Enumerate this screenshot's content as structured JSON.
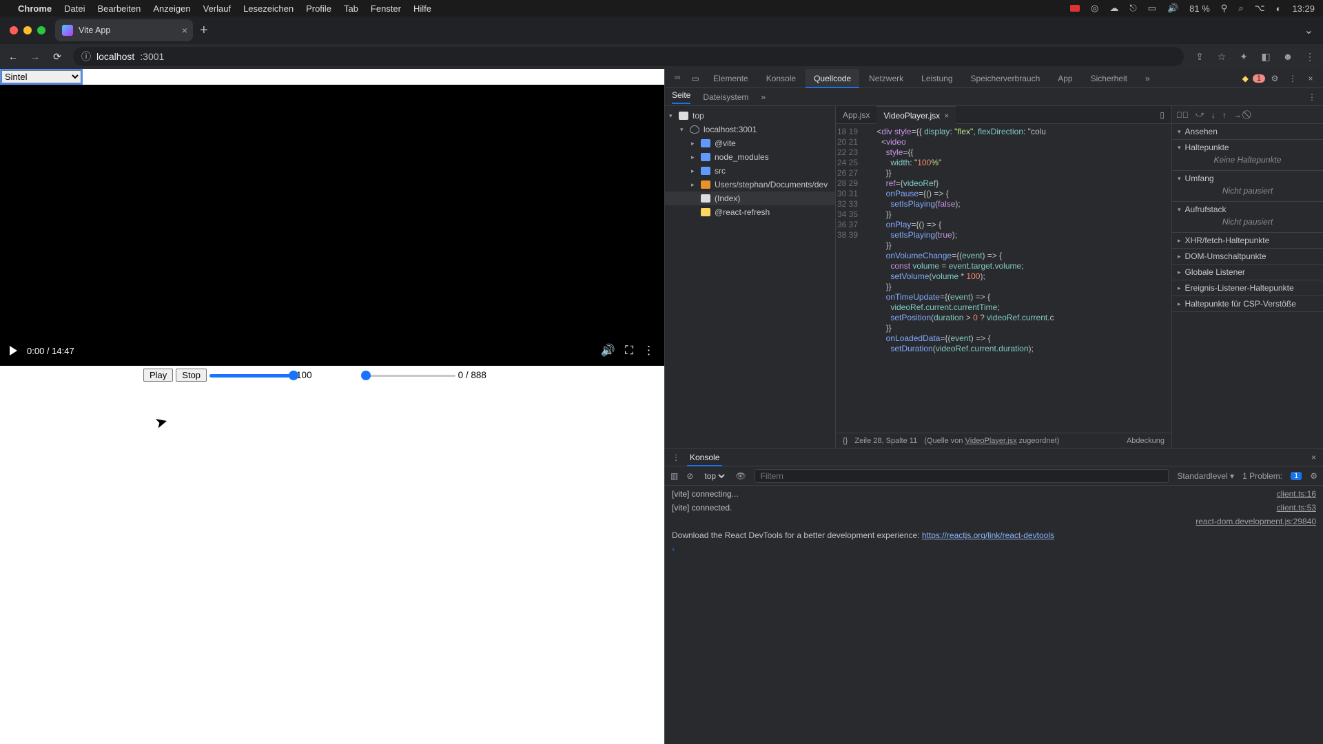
{
  "menubar": {
    "app": "Chrome",
    "items": [
      "Datei",
      "Bearbeiten",
      "Anzeigen",
      "Verlauf",
      "Lesezeichen",
      "Profile",
      "Tab",
      "Fenster",
      "Hilfe"
    ],
    "battery": "81 %",
    "clock": "13:29"
  },
  "browser": {
    "tab_title": "Vite App",
    "url_host": "localhost",
    "url_port": ":3001"
  },
  "page": {
    "select_value": "Sintel",
    "time": "0:00 / 14:47",
    "play_btn": "Play",
    "stop_btn": "Stop",
    "volume_value": "100",
    "position_value": "0 / 888"
  },
  "devtools": {
    "tabs": [
      "Elemente",
      "Konsole",
      "Quellcode",
      "Netzwerk",
      "Leistung",
      "Speicherverbrauch",
      "App",
      "Sicherheit"
    ],
    "active_tab": "Quellcode",
    "error_count": "1",
    "src_tabs": {
      "page": "Seite",
      "fs": "Dateisystem"
    },
    "tree": {
      "top": "top",
      "host": "localhost:3001",
      "vite": "@vite",
      "nm": "node_modules",
      "src": "src",
      "users": "Users/stephan/Documents/dev",
      "index": "(Index)",
      "rr": "@react-refresh"
    },
    "editor": {
      "tab1": "App.jsx",
      "tab2": "VideoPlayer.jsx",
      "first_line": 18,
      "lines": [
        "    <div style={{ display: \"flex\", flexDirection: \"colu",
        "      <video",
        "        style={{",
        "          width: \"100%\"",
        "        }}",
        "        ref={videoRef}",
        "        onPause={() => {",
        "          setIsPlaying(false);",
        "        }}",
        "        onPlay={() => {",
        "          setIsPlaying(true);",
        "        }}",
        "        onVolumeChange={(event) => {",
        "          const volume = event.target.volume;",
        "          setVolume(volume * 100);",
        "        }}",
        "        onTimeUpdate={(event) => {",
        "          videoRef.current.currentTime;",
        "          setPosition(duration > 0 ? videoRef.current.c",
        "        }}",
        "        onLoadedData={(event) => {",
        "          setDuration(videoRef.current.duration);"
      ],
      "status_pos": "Zeile 28, Spalte 11",
      "status_src_pre": "(Quelle von ",
      "status_src_link": "VideoPlayer.jsx",
      "status_src_post": " zugeordnet)",
      "status_cov": "Abdeckung"
    },
    "debugger": {
      "watch": "Ansehen",
      "bp": "Haltepunkte",
      "bp_empty": "Keine Haltepunkte",
      "scope": "Umfang",
      "scope_empty": "Nicht pausiert",
      "callstack": "Aufrufstack",
      "callstack_empty": "Nicht pausiert",
      "xhr": "XHR/fetch-Haltepunkte",
      "dom": "DOM-Umschaltpunkte",
      "gl": "Globale Listener",
      "ev": "Ereignis-Listener-Haltepunkte",
      "csp": "Haltepunkte für CSP-Verstöße"
    },
    "console": {
      "title": "Konsole",
      "ctx": "top",
      "filter_ph": "Filtern",
      "level": "Standardlevel",
      "problem": "1 Problem:",
      "problem_badge": "1",
      "rows": [
        {
          "msg": "[vite] connecting...",
          "src": "client.ts:16"
        },
        {
          "msg": "[vite] connected.",
          "src": "client.ts:53"
        },
        {
          "msg": "",
          "src": "react-dom.development.js:29840"
        },
        {
          "msg": "Download the React DevTools for a better development experience: ",
          "link": "https://reactjs.org/link/react-devtools"
        }
      ]
    }
  }
}
